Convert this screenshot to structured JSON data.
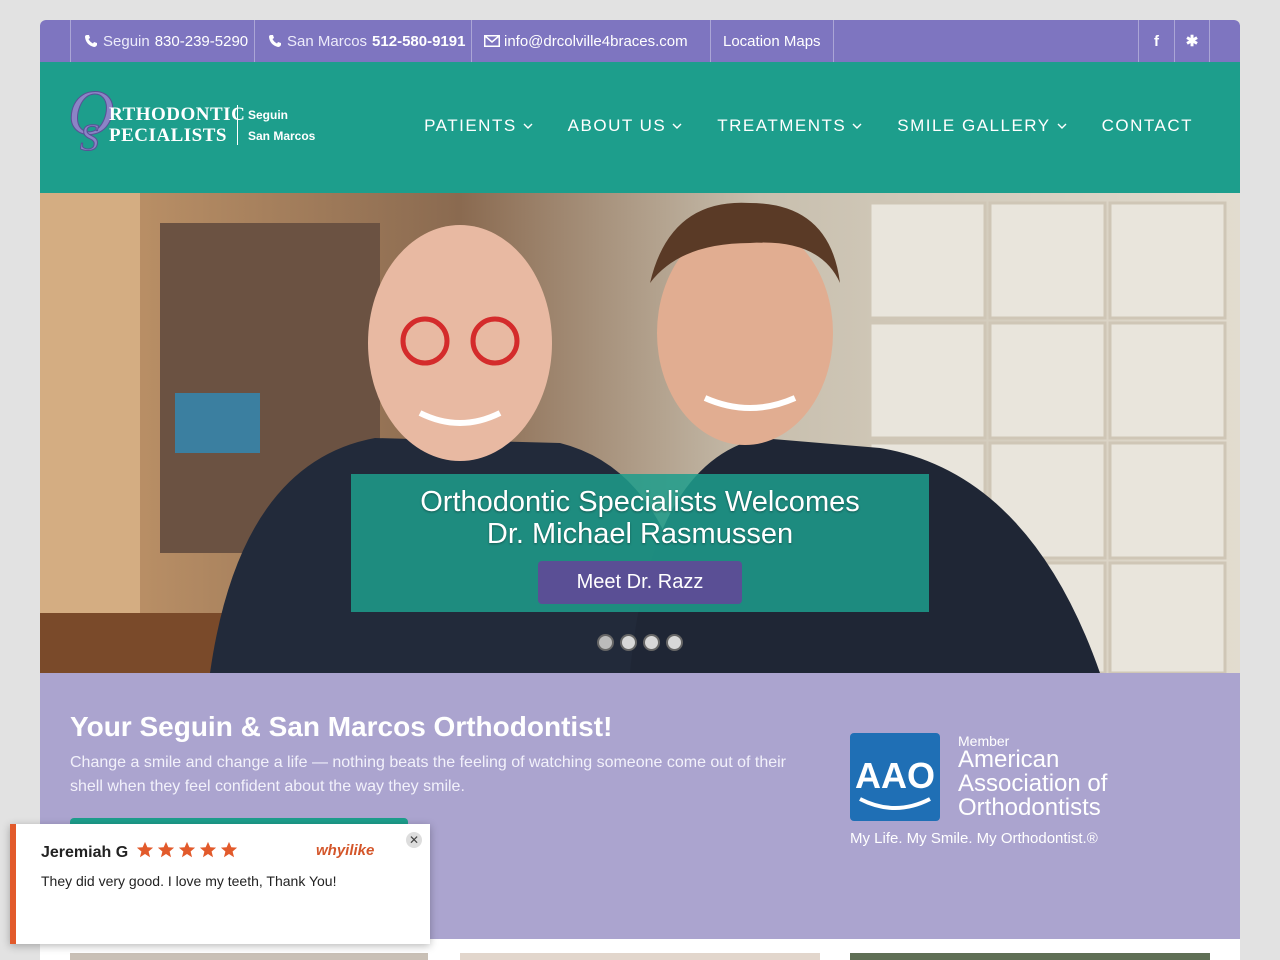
{
  "topbar": {
    "seguin_label": "Seguin",
    "seguin_phone": "830-239-5290",
    "sanmarcos_label": "San Marcos",
    "sanmarcos_phone": "512-580-9191",
    "email": "info@drcolville4braces.com",
    "maps": "Location Maps",
    "social": [
      {
        "icon": "facebook-icon",
        "glyph": "f"
      },
      {
        "icon": "yelp-icon",
        "glyph": "✱"
      }
    ]
  },
  "logo": {
    "line1": "RTHODONTIC",
    "line2": "PECIALISTS",
    "loc1": "Seguin",
    "loc2": "San Marcos"
  },
  "nav": [
    {
      "label": "PATIENTS",
      "dropdown": true
    },
    {
      "label": "ABOUT US",
      "dropdown": true
    },
    {
      "label": "TREATMENTS",
      "dropdown": true
    },
    {
      "label": "SMILE GALLERY",
      "dropdown": true
    },
    {
      "label": "CONTACT",
      "dropdown": false
    }
  ],
  "hero": {
    "title_line1": "Orthodontic Specialists Welcomes",
    "title_line2": "Dr. Michael Rasmussen",
    "button": "Meet Dr. Razz",
    "slide_count": 4,
    "active_slide": 1
  },
  "intro": {
    "title": "Your Seguin & San Marcos Orthodontist!",
    "text": "Change a smile and change a life — nothing beats the feeling of watching someone come out of their shell when they feel confident about the way they smile."
  },
  "aao": {
    "logo_text": "AAO",
    "member": "Member",
    "name": "American Association of Orthodontists",
    "tagline": "My Life. My Smile. My Orthodontist.®"
  },
  "review": {
    "name": "Jeremiah G",
    "stars": 5,
    "brand": "whyilike",
    "text": "They did very good. I love my teeth, Thank You!"
  },
  "colors": {
    "topbar": "#7e75c0",
    "header": "#1d9e8c",
    "intro_bg": "#aba4cf",
    "button": "#5a4f95",
    "star": "#e25a2b"
  }
}
